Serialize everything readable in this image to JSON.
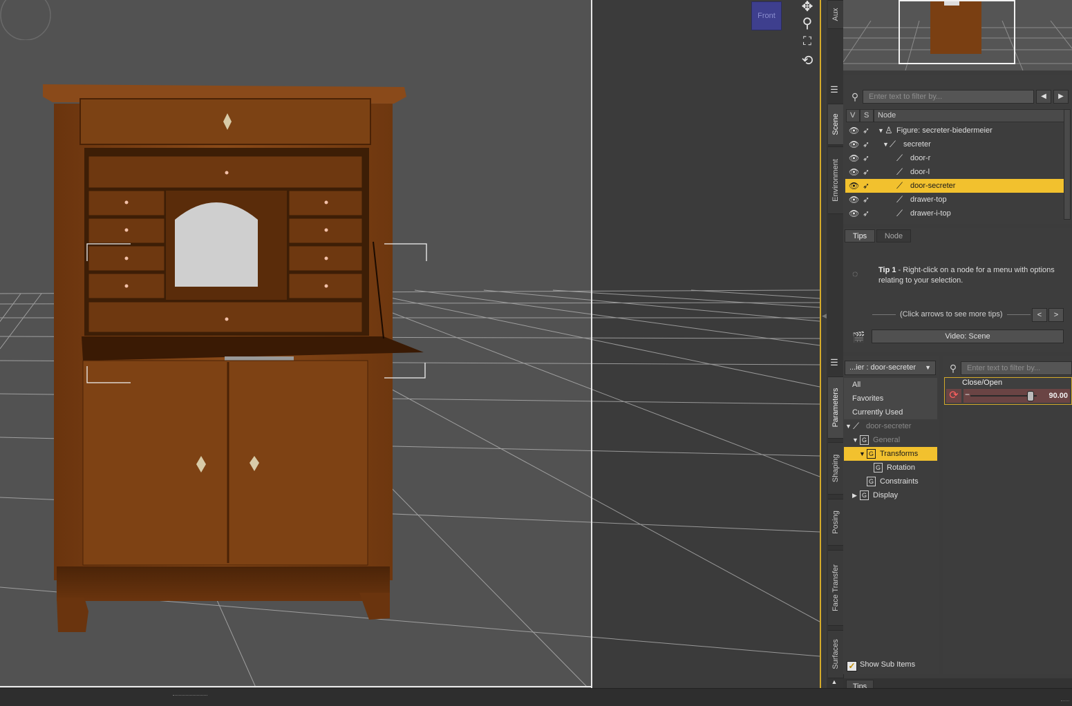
{
  "viewport": {
    "view_cube_label": "Front"
  },
  "side_tabs": {
    "aux": "Aux",
    "scene": "Scene",
    "environment": "Environment",
    "parameters": "Parameters",
    "shaping": "Shaping",
    "posing": "Posing",
    "face_transfer": "Face Transfer",
    "surfaces": "Surfaces"
  },
  "scene": {
    "filter_placeholder": "Enter text to filter by...",
    "columns": {
      "v": "V",
      "s": "S",
      "node": "Node"
    },
    "rows": [
      {
        "label": "Figure: secreter-biedermeier",
        "depth": 0,
        "expanded": true,
        "icon": "figure-icon"
      },
      {
        "label": "secreter",
        "depth": 1,
        "expanded": true,
        "icon": "bone-icon"
      },
      {
        "label": "door-r",
        "depth": 2,
        "icon": "bone-icon"
      },
      {
        "label": "door-l",
        "depth": 2,
        "icon": "bone-icon"
      },
      {
        "label": "door-secreter",
        "depth": 2,
        "icon": "bone-icon",
        "selected": true
      },
      {
        "label": "drawer-top",
        "depth": 2,
        "icon": "bone-icon"
      },
      {
        "label": "drawer-i-top",
        "depth": 2,
        "icon": "bone-icon"
      }
    ]
  },
  "tips": {
    "tabs": [
      "Tips",
      "Node"
    ],
    "tip_title": "Tip 1",
    "tip_body": " - Right-click on a node for a menu with options relating to your selection.",
    "arrows_hint": "(Click arrows to see more tips)",
    "prev": "<",
    "next": ">",
    "video_button": "Video: Scene"
  },
  "parameters": {
    "node_selector": "...ier : door-secreter",
    "filter_placeholder": "Enter text to filter by...",
    "categories": [
      "All",
      "Favorites",
      "Currently Used"
    ],
    "tree": {
      "node": "door-secreter",
      "general": "General",
      "transforms": "Transforms",
      "rotation": "Rotation",
      "constraints": "Constraints",
      "display": "Display",
      "group_badge": "G"
    },
    "property": {
      "label": "Close/Open",
      "value": "90.00",
      "level": 0.9,
      "minus": "−"
    },
    "show_sub_items": "Show Sub Items",
    "show_sub_items_checked": true
  },
  "bottom_tab": "Tips",
  "colors": {
    "selection": "#f2c12e",
    "panel": "#3d3d3d",
    "viewport": "#525252",
    "wood": "#7a3f12"
  }
}
